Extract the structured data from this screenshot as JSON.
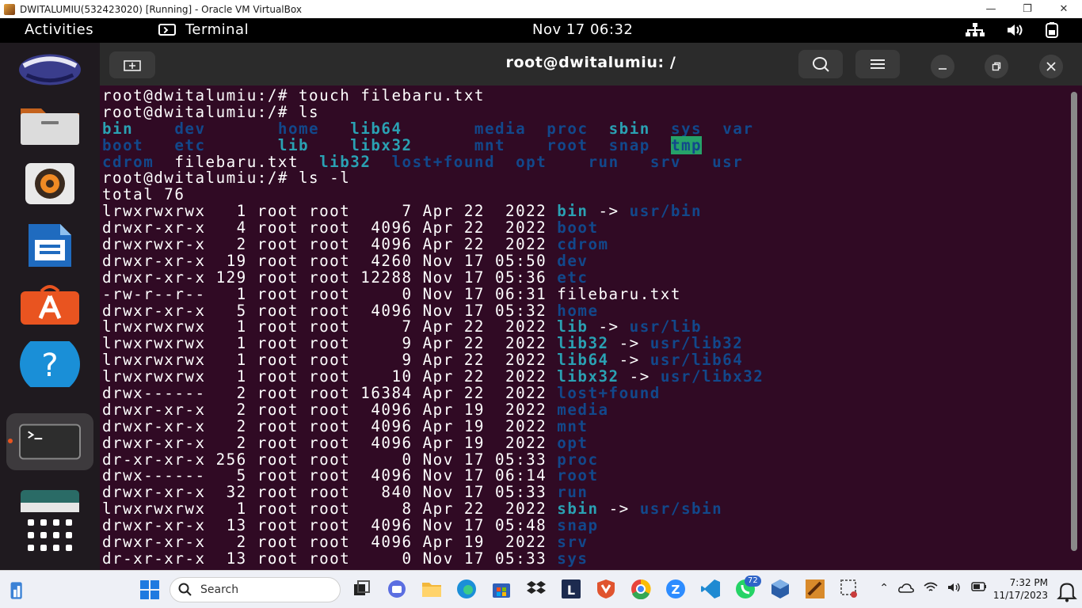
{
  "vbox": {
    "title": "DWITALUMIU(532423020) [Running] - Oracle VM VirtualBox",
    "minimize": "—",
    "maximize": "❐",
    "close": "✕"
  },
  "topbar": {
    "activities": "Activities",
    "app": "Terminal",
    "clock": "Nov 17  06:32"
  },
  "terminal": {
    "title": "root@dwitalumiu: /",
    "lines": [
      [
        [
          "root@dwitalumiu:/# touch filebaru.txt",
          "w"
        ]
      ],
      [
        [
          "root@dwitalumiu:/# ls",
          "w"
        ]
      ],
      [
        [
          "bin",
          "c"
        ],
        [
          "    ",
          "w"
        ],
        [
          "dev",
          "b"
        ],
        [
          "       ",
          "w"
        ],
        [
          "home",
          "b"
        ],
        [
          "   ",
          "w"
        ],
        [
          "lib64",
          "c"
        ],
        [
          "       ",
          "w"
        ],
        [
          "media",
          "b"
        ],
        [
          "  ",
          "w"
        ],
        [
          "proc",
          "b"
        ],
        [
          "  ",
          "w"
        ],
        [
          "sbin",
          "c"
        ],
        [
          "  ",
          "w"
        ],
        [
          "sys",
          "b"
        ],
        [
          "  ",
          "w"
        ],
        [
          "var",
          "b"
        ]
      ],
      [
        [
          "boot",
          "b"
        ],
        [
          "   ",
          "w"
        ],
        [
          "etc",
          "b"
        ],
        [
          "       ",
          "w"
        ],
        [
          "lib",
          "c"
        ],
        [
          "    ",
          "w"
        ],
        [
          "libx32",
          "c"
        ],
        [
          "      ",
          "w"
        ],
        [
          "mnt",
          "b"
        ],
        [
          "    ",
          "w"
        ],
        [
          "root",
          "b"
        ],
        [
          "  ",
          "w"
        ],
        [
          "snap",
          "b"
        ],
        [
          "  ",
          "w"
        ],
        [
          "tmp",
          "tmp"
        ]
      ],
      [
        [
          "cdrom",
          "b"
        ],
        [
          "  ",
          "w"
        ],
        [
          "filebaru.txt",
          "w"
        ],
        [
          "  ",
          "w"
        ],
        [
          "lib32",
          "c"
        ],
        [
          "  ",
          "w"
        ],
        [
          "lost+found",
          "b"
        ],
        [
          "  ",
          "w"
        ],
        [
          "opt",
          "b"
        ],
        [
          "    ",
          "w"
        ],
        [
          "run",
          "b"
        ],
        [
          "   ",
          "w"
        ],
        [
          "srv",
          "b"
        ],
        [
          "   ",
          "w"
        ],
        [
          "usr",
          "b"
        ]
      ],
      [
        [
          "root@dwitalumiu:/# ls -l",
          "w"
        ]
      ],
      [
        [
          "total 76",
          "w"
        ]
      ],
      [
        [
          "lrwxrwxrwx   1 root root     7 Apr 22  2022 ",
          "w"
        ],
        [
          "bin",
          "c"
        ],
        [
          " -> ",
          "w"
        ],
        [
          "usr/bin",
          "b"
        ]
      ],
      [
        [
          "drwxr-xr-x   4 root root  4096 Apr 22  2022 ",
          "w"
        ],
        [
          "boot",
          "b"
        ]
      ],
      [
        [
          "drwxrwxr-x   2 root root  4096 Apr 22  2022 ",
          "w"
        ],
        [
          "cdrom",
          "b"
        ]
      ],
      [
        [
          "drwxr-xr-x  19 root root  4260 Nov 17 05:50 ",
          "w"
        ],
        [
          "dev",
          "b"
        ]
      ],
      [
        [
          "drwxr-xr-x 129 root root 12288 Nov 17 05:36 ",
          "w"
        ],
        [
          "etc",
          "b"
        ]
      ],
      [
        [
          "-rw-r--r--   1 root root     0 Nov 17 06:31 filebaru.txt",
          "w"
        ]
      ],
      [
        [
          "drwxr-xr-x   5 root root  4096 Nov 17 05:32 ",
          "w"
        ],
        [
          "home",
          "b"
        ]
      ],
      [
        [
          "lrwxrwxrwx   1 root root     7 Apr 22  2022 ",
          "w"
        ],
        [
          "lib",
          "c"
        ],
        [
          " -> ",
          "w"
        ],
        [
          "usr/lib",
          "b"
        ]
      ],
      [
        [
          "lrwxrwxrwx   1 root root     9 Apr 22  2022 ",
          "w"
        ],
        [
          "lib32",
          "c"
        ],
        [
          " -> ",
          "w"
        ],
        [
          "usr/lib32",
          "b"
        ]
      ],
      [
        [
          "lrwxrwxrwx   1 root root     9 Apr 22  2022 ",
          "w"
        ],
        [
          "lib64",
          "c"
        ],
        [
          " -> ",
          "w"
        ],
        [
          "usr/lib64",
          "b"
        ]
      ],
      [
        [
          "lrwxrwxrwx   1 root root    10 Apr 22  2022 ",
          "w"
        ],
        [
          "libx32",
          "c"
        ],
        [
          " -> ",
          "w"
        ],
        [
          "usr/libx32",
          "b"
        ]
      ],
      [
        [
          "drwx------   2 root root 16384 Apr 22  2022 ",
          "w"
        ],
        [
          "lost+found",
          "b"
        ]
      ],
      [
        [
          "drwxr-xr-x   2 root root  4096 Apr 19  2022 ",
          "w"
        ],
        [
          "media",
          "b"
        ]
      ],
      [
        [
          "drwxr-xr-x   2 root root  4096 Apr 19  2022 ",
          "w"
        ],
        [
          "mnt",
          "b"
        ]
      ],
      [
        [
          "drwxr-xr-x   2 root root  4096 Apr 19  2022 ",
          "w"
        ],
        [
          "opt",
          "b"
        ]
      ],
      [
        [
          "dr-xr-xr-x 256 root root     0 Nov 17 05:33 ",
          "w"
        ],
        [
          "proc",
          "b"
        ]
      ],
      [
        [
          "drwx------   5 root root  4096 Nov 17 06:14 ",
          "w"
        ],
        [
          "root",
          "b"
        ]
      ],
      [
        [
          "drwxr-xr-x  32 root root   840 Nov 17 05:33 ",
          "w"
        ],
        [
          "run",
          "b"
        ]
      ],
      [
        [
          "lrwxrwxrwx   1 root root     8 Apr 22  2022 ",
          "w"
        ],
        [
          "sbin",
          "c"
        ],
        [
          " -> ",
          "w"
        ],
        [
          "usr/sbin",
          "b"
        ]
      ],
      [
        [
          "drwxr-xr-x  13 root root  4096 Nov 17 05:48 ",
          "w"
        ],
        [
          "snap",
          "b"
        ]
      ],
      [
        [
          "drwxr-xr-x   2 root root  4096 Apr 19  2022 ",
          "w"
        ],
        [
          "srv",
          "b"
        ]
      ],
      [
        [
          "dr-xr-xr-x  13 root root     0 Nov 17 05:33 ",
          "w"
        ],
        [
          "sys",
          "b"
        ]
      ]
    ]
  },
  "taskbar": {
    "search_placeholder": "Search",
    "badge": "72",
    "time": "7:32 PM",
    "date": "11/17/2023"
  },
  "dock_icons": [
    "ubuntu-logo-icon",
    "files-icon",
    "rhythmbox-icon",
    "writer-icon",
    "app-center-icon",
    "help-icon",
    "terminal-icon",
    "show-apps-icon"
  ]
}
